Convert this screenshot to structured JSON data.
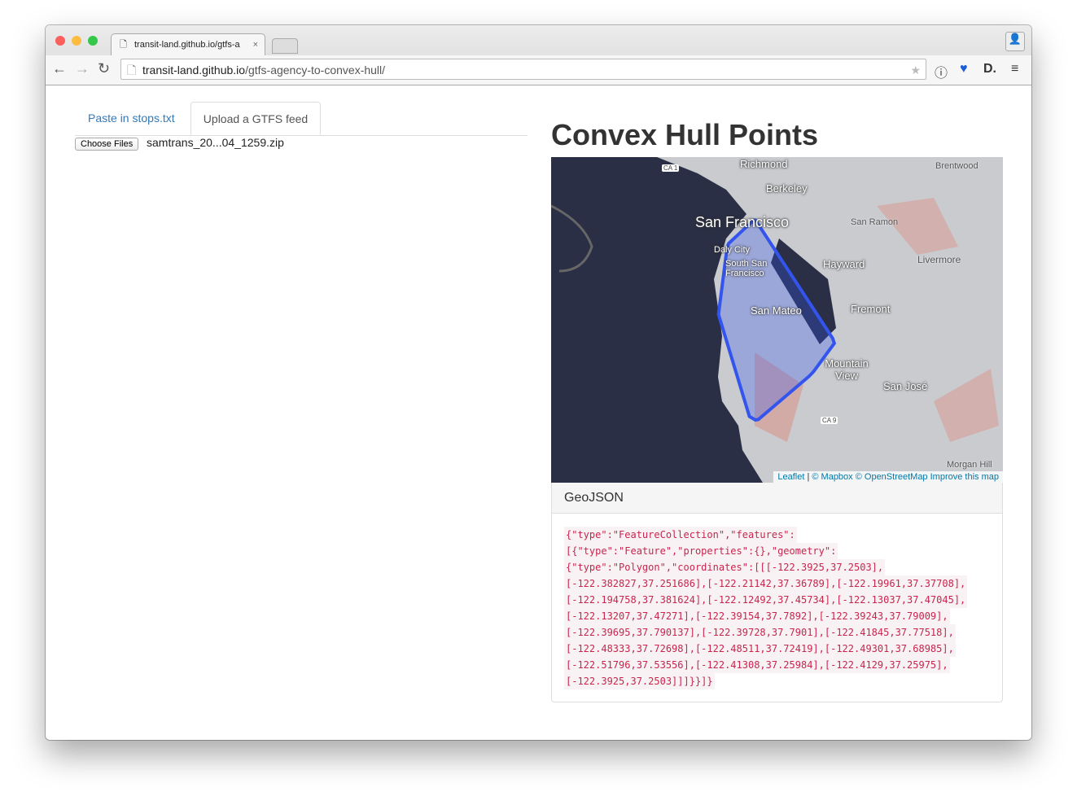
{
  "browser": {
    "tab_title": "transit-land.github.io/gtfs-a",
    "url_host": "transit-land.github.io",
    "url_path": "/gtfs-agency-to-convex-hull/"
  },
  "tabs": [
    {
      "label": "Paste in stops.txt",
      "active": false
    },
    {
      "label": "Upload a GTFS feed",
      "active": true
    }
  ],
  "upload": {
    "button_label": "Choose Files",
    "file_name": "samtrans_20...04_1259.zip"
  },
  "title": "Convex Hull Points",
  "map": {
    "labels": [
      "Richmond",
      "Berkeley",
      "Brentwood",
      "San Francisco",
      "San Ramon",
      "Daly City",
      "South San Francisco",
      "Hayward",
      "Livermore",
      "San Mateo",
      "Fremont",
      "Mountain View",
      "San José",
      "Morgan Hill"
    ],
    "shields": [
      "CA 1",
      "CA 9"
    ],
    "attribution": {
      "leaflet": "Leaflet",
      "sep": " | ",
      "mapbox": "© Mapbox",
      "osm": "© OpenStreetMap",
      "improve": "Improve this map"
    },
    "hull_color": "#3355ee",
    "hull": [
      [
        -122.3925,
        37.2503
      ],
      [
        -122.382827,
        37.251686
      ],
      [
        -122.21142,
        37.36789
      ],
      [
        -122.19961,
        37.37708
      ],
      [
        -122.194758,
        37.381624
      ],
      [
        -122.12492,
        37.45734
      ],
      [
        -122.13037,
        37.47045
      ],
      [
        -122.13207,
        37.47271
      ],
      [
        -122.39154,
        37.7892
      ],
      [
        -122.39243,
        37.79009
      ],
      [
        -122.39695,
        37.790137
      ],
      [
        -122.39728,
        37.7901
      ],
      [
        -122.41845,
        37.77518
      ],
      [
        -122.48333,
        37.72698
      ],
      [
        -122.48511,
        37.72419
      ],
      [
        -122.49301,
        37.68985
      ],
      [
        -122.51796,
        37.53556
      ],
      [
        -122.41308,
        37.25984
      ],
      [
        -122.4129,
        37.25975
      ],
      [
        -122.3925,
        37.2503
      ]
    ]
  },
  "geojson": {
    "heading": "GeoJSON",
    "lines": [
      "{\"type\":\"FeatureCollection\",\"features\":",
      "[{\"type\":\"Feature\",\"properties\":{},\"geometry\":",
      "{\"type\":\"Polygon\",\"coordinates\":[[[-122.3925,37.2503],",
      "[-122.382827,37.251686],[-122.21142,37.36789],[-122.19961,37.37708],",
      "[-122.194758,37.381624],[-122.12492,37.45734],[-122.13037,37.47045],",
      "[-122.13207,37.47271],[-122.39154,37.7892],[-122.39243,37.79009],",
      "[-122.39695,37.790137],[-122.39728,37.7901],[-122.41845,37.77518],",
      "[-122.48333,37.72698],[-122.48511,37.72419],[-122.49301,37.68985],",
      "[-122.51796,37.53556],[-122.41308,37.25984],[-122.4129,37.25975],",
      "[-122.3925,37.2503]]]}}]}"
    ]
  }
}
